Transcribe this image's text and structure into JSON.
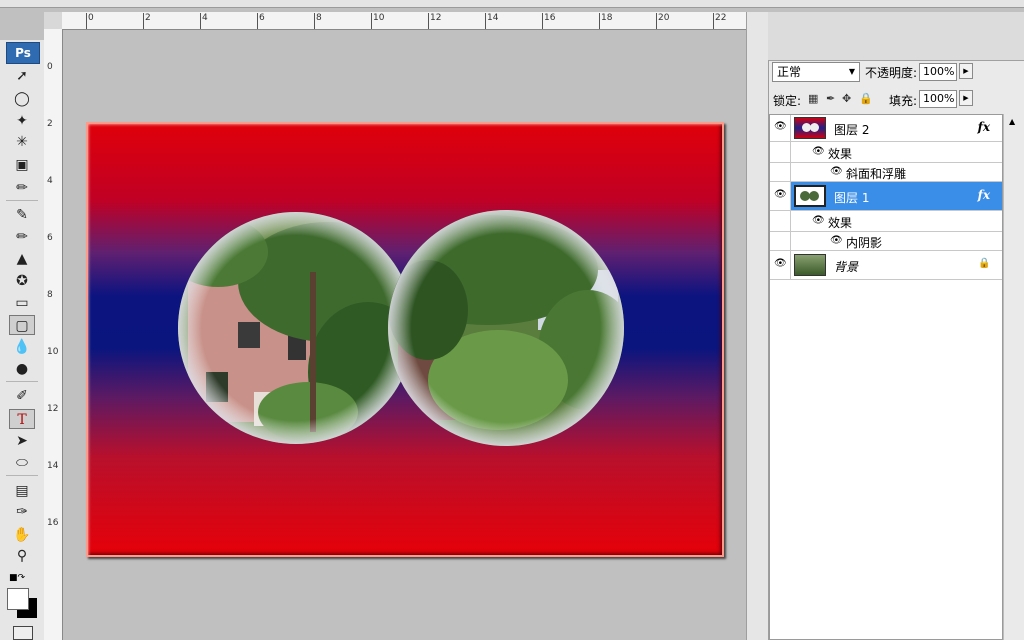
{
  "app": {
    "logo": "Ps"
  },
  "ruler": {
    "h_ticks": [
      "0",
      "2",
      "4",
      "6",
      "8",
      "10",
      "12",
      "14",
      "16",
      "18",
      "20",
      "22"
    ],
    "v_ticks": [
      "0",
      "2",
      "4",
      "6",
      "8",
      "10",
      "12",
      "14",
      "16"
    ]
  },
  "layers_panel": {
    "blend_mode": "正常",
    "opacity_label": "不透明度:",
    "opacity_value": "100%",
    "lock_label": "锁定:",
    "fill_label": "填充:",
    "fill_value": "100%",
    "layers": [
      {
        "name": "图层 2",
        "fx": "fx",
        "selected": false,
        "effects_label": "效果",
        "effects": [
          "斜面和浮雕"
        ]
      },
      {
        "name": "图层 1",
        "fx": "fx",
        "selected": true,
        "effects_label": "效果",
        "effects": [
          "内阴影"
        ]
      },
      {
        "name": "背景",
        "locked": true
      }
    ]
  },
  "colors": {
    "canvas_bg": "#c0c0c0",
    "selected_layer": "#3b8ee8",
    "gradient_red": "#e0000a",
    "gradient_blue": "#0a157e"
  },
  "icons": [
    "eye-icon",
    "lock-icon",
    "move-tool-icon",
    "marquee-tool-icon",
    "lasso-tool-icon",
    "magic-wand-icon",
    "crop-tool-icon",
    "eyedropper-icon",
    "healing-brush-icon",
    "brush-tool-icon",
    "clone-stamp-icon",
    "history-brush-icon",
    "eraser-icon",
    "gradient-tool-icon",
    "blur-tool-icon",
    "dodge-tool-icon",
    "pen-tool-icon",
    "type-tool-icon",
    "path-selection-icon",
    "shape-tool-icon",
    "notes-icon",
    "eyedropper-icon",
    "hand-tool-icon",
    "zoom-tool-icon"
  ]
}
